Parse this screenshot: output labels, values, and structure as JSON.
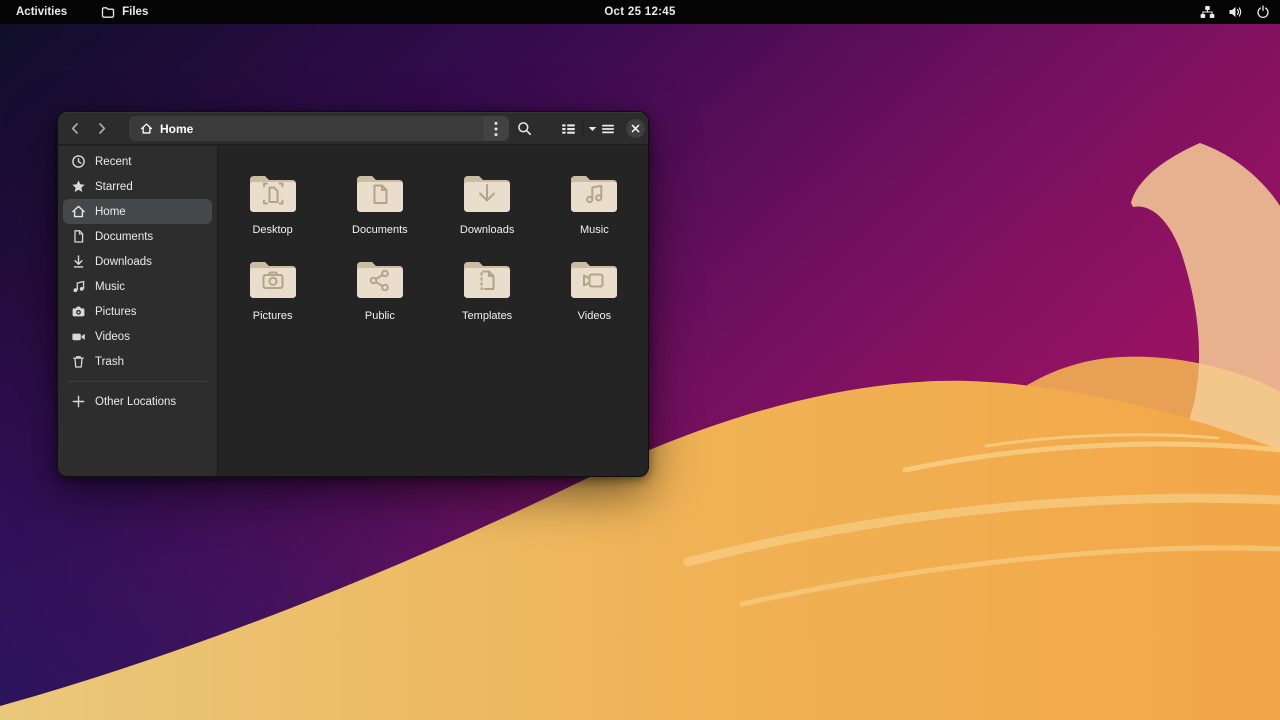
{
  "topbar": {
    "activities_label": "Activities",
    "app_name": "Files",
    "clock": "Oct 25 12:45",
    "status_icons": [
      "network-icon",
      "volume-icon",
      "power-icon"
    ]
  },
  "window": {
    "headerbar": {
      "path_label": "Home",
      "buttons": [
        "back",
        "forward",
        "path-menu",
        "search",
        "view-list",
        "view-caret",
        "main-menu",
        "close"
      ]
    },
    "sidebar": {
      "items": [
        {
          "label": "Recent",
          "icon": "recent-icon",
          "selected": false
        },
        {
          "label": "Starred",
          "icon": "starred-icon",
          "selected": false
        },
        {
          "label": "Home",
          "icon": "home-icon",
          "selected": true
        },
        {
          "label": "Documents",
          "icon": "document-icon",
          "selected": false
        },
        {
          "label": "Downloads",
          "icon": "download-icon",
          "selected": false
        },
        {
          "label": "Music",
          "icon": "music-icon",
          "selected": false
        },
        {
          "label": "Pictures",
          "icon": "camera-icon",
          "selected": false
        },
        {
          "label": "Videos",
          "icon": "video-icon",
          "selected": false
        },
        {
          "label": "Trash",
          "icon": "trash-icon",
          "selected": false
        }
      ],
      "other_locations": {
        "label": "Other Locations",
        "icon": "plus-icon"
      }
    },
    "files": [
      {
        "name": "Desktop",
        "emblem": "desktop"
      },
      {
        "name": "Documents",
        "emblem": "document"
      },
      {
        "name": "Downloads",
        "emblem": "download-arrow"
      },
      {
        "name": "Music",
        "emblem": "music-notes"
      },
      {
        "name": "Pictures",
        "emblem": "camera"
      },
      {
        "name": "Public",
        "emblem": "share"
      },
      {
        "name": "Templates",
        "emblem": "dotted-document"
      },
      {
        "name": "Videos",
        "emblem": "camcorder"
      }
    ]
  },
  "colors": {
    "folder_front": "#e8decb",
    "folder_back": "#cbbda3",
    "folder_emblem": "#b3a488",
    "headerbar": "#2c2c2c",
    "sidebar": "#2d2d2d",
    "content_bg": "#242424",
    "selected_row": "#45484b",
    "wallpaper_magenta": "#a21363",
    "wallpaper_indigo": "#28155e",
    "wallpaper_dune_orange": "#f2a748",
    "wallpaper_dune_sand": "#e9c87b",
    "wallpaper_petal": "#f5cc95"
  }
}
